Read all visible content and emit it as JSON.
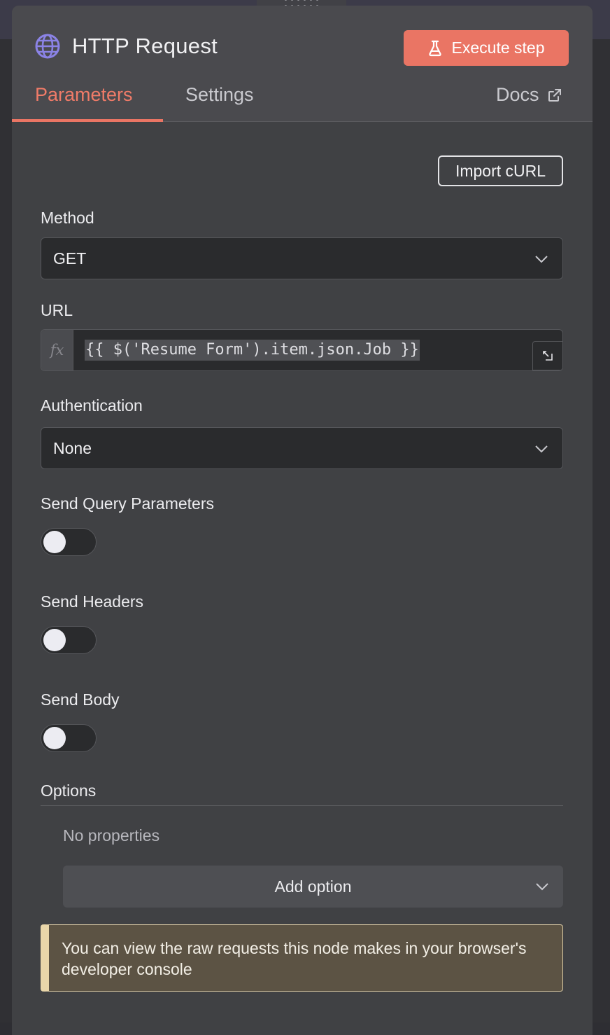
{
  "node": {
    "title": "HTTP Request",
    "icon": "globe-icon",
    "execute_label": "Execute step"
  },
  "tabs": [
    {
      "label": "Parameters",
      "active": true
    },
    {
      "label": "Settings",
      "active": false
    }
  ],
  "docs_label": "Docs",
  "import_curl_label": "Import cURL",
  "method": {
    "label": "Method",
    "value": "GET"
  },
  "url": {
    "label": "URL",
    "fx": "fx",
    "value": "{{ $('Resume Form').item.json.Job }}"
  },
  "authentication": {
    "label": "Authentication",
    "value": "None"
  },
  "toggles": [
    {
      "label": "Send Query Parameters",
      "on": false
    },
    {
      "label": "Send Headers",
      "on": false
    },
    {
      "label": "Send Body",
      "on": false
    }
  ],
  "options": {
    "label": "Options",
    "empty_text": "No properties",
    "add_label": "Add option"
  },
  "notice": "You can view the raw requests this node makes in your browser's developer console",
  "colors": {
    "accent": "#ea7564",
    "panel_bg": "#404144",
    "header_bg": "#4a4a4e",
    "input_bg": "#2a2b2d",
    "notice_bg": "#5c5344",
    "notice_border": "#e9d6a9",
    "globe": "#8b83e6"
  }
}
